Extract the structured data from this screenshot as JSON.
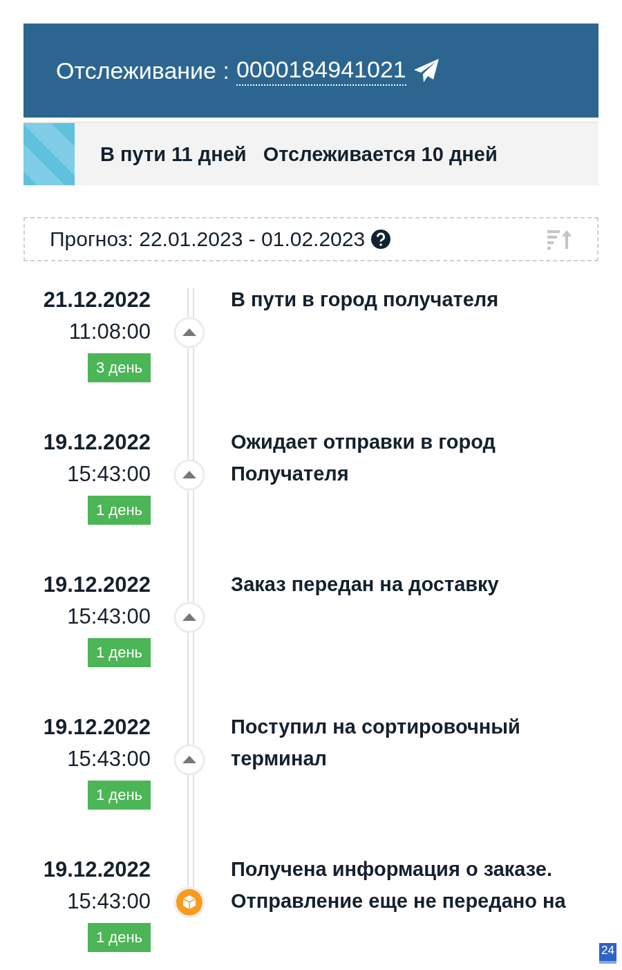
{
  "header": {
    "label": "Отслеживание :",
    "tracking_number": "0000184941021"
  },
  "stats": {
    "in_transit": "В пути 11 дней",
    "tracked": "Отслеживается 10 дней"
  },
  "forecast": {
    "text": "Прогноз: 22.01.2023 - 01.02.2023"
  },
  "events": [
    {
      "kind": "arrow",
      "date": "21.12.2022",
      "time": "11:08:00",
      "days": "3 день",
      "title": "В пути в город получателя"
    },
    {
      "kind": "arrow",
      "date": "19.12.2022",
      "time": "15:43:00",
      "days": "1 день",
      "title": "Ожидает отправки в город Получателя"
    },
    {
      "kind": "arrow",
      "date": "19.12.2022",
      "time": "15:43:00",
      "days": "1 день",
      "title": "Заказ передан на доставку"
    },
    {
      "kind": "arrow",
      "date": "19.12.2022",
      "time": "15:43:00",
      "days": "1 день",
      "title": "Поступил на сортировочный терминал"
    },
    {
      "kind": "box",
      "date": "19.12.2022",
      "time": "15:43:00",
      "days": "1 день",
      "title": "Получена информация о заказе. Отправление еще не передано на"
    }
  ],
  "corner_badge": "24"
}
